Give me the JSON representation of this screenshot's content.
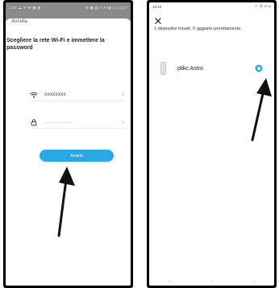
{
  "left_screen": {
    "status_left": "1:56 ☁ ✉ ⚙ ▣ ◉",
    "status_right": "⊕ ▣ ▤ 4.4%▮ ▭ 11:57",
    "cancel_label": "Annulla",
    "heading": "Scegliere la rete Wi-Fi e immettere la password",
    "ssid_value": "XXXXXXXX",
    "ssid_right_hint": "≋",
    "password_value": "...................",
    "password_toggle": "◎",
    "next_button": "Avanti"
  },
  "right_screen": {
    "status_time": "10:44",
    "status_right": "⚡ ✆ .ıl ▭",
    "found_text": "1 dispositivi trovati. 0 aggiunti correttamente.",
    "device_name": "plikc Astro",
    "nav_items": [
      "≡",
      "□",
      "◁"
    ]
  },
  "colors": {
    "accent": "#29a8e6",
    "dim_overlay": "#8a8a8a",
    "arrow": "#111111"
  },
  "icons": {
    "wifi": "wifi-icon",
    "lock": "lock-icon",
    "eye": "eye-icon",
    "close": "close-icon",
    "device": "device-thumbnail",
    "check": "check-icon",
    "arrow": "arrow-up-icon"
  }
}
